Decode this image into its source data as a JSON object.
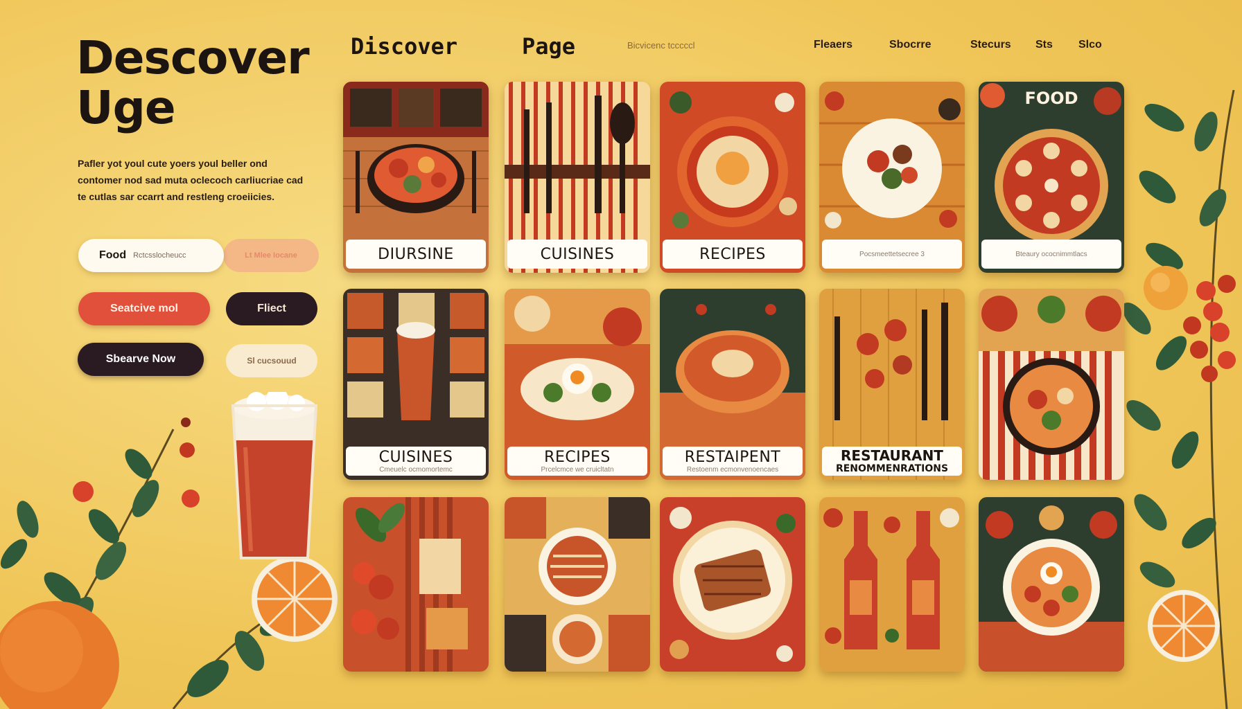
{
  "hero": {
    "line1": "Descover",
    "line2": "Uge"
  },
  "nav": {
    "brand": "Discover",
    "page": "Page",
    "faint": "Bicvicenc tcccccl",
    "links": [
      "Fleaers",
      "Sbocrre",
      "Stecurs",
      "Sts",
      "Slco"
    ]
  },
  "intro": "Pafler yot youl cute yoers youl beller ond contomer nod sad muta oclecoch carliucriae cad te cutlas sar ccarrt and restleng croeiicies.",
  "buttons": {
    "food": "Food",
    "food_sub": "Rctcsslocheucc",
    "food_b": "Lt Mlee Iocane",
    "red": "Seatcive mol",
    "dark": "Fliect",
    "now": "Sbearve Now",
    "light": "Sl cucsouud"
  },
  "cards": [
    {
      "label": "DIURSINE"
    },
    {
      "label": "CUISINES"
    },
    {
      "label": "RECIPES"
    },
    {
      "label": "",
      "small": "Pocsmeettetsecree 3"
    },
    {
      "label": "",
      "small": "Bteaury ococnimmtlacs",
      "tag": "FOOD"
    },
    {
      "label": "CUISINES",
      "small": "Cmeuelc ocmomortemc"
    },
    {
      "label": "RECIPES",
      "small": "Prcelcmce we cruicltatn"
    },
    {
      "label": "RESTAIPENT",
      "small": "Restoenm ecmonvenoencaes"
    },
    {
      "label": "RESTAURANT",
      "label2": "RENOMMENRATIONS"
    },
    {
      "label": ""
    },
    {
      "label": ""
    },
    {
      "label": ""
    },
    {
      "label": ""
    },
    {
      "label": ""
    },
    {
      "label": ""
    }
  ],
  "colors": {
    "background": "#f2cc62",
    "accent_red": "#e0503a",
    "dark": "#2a1a22",
    "cream": "#fffaf0"
  },
  "icons": [
    "hero-beer-glass-icon",
    "orange-icon",
    "leaf-branch-icon",
    "cherry-icon",
    "plate-icon",
    "fork-knife-icon"
  ]
}
